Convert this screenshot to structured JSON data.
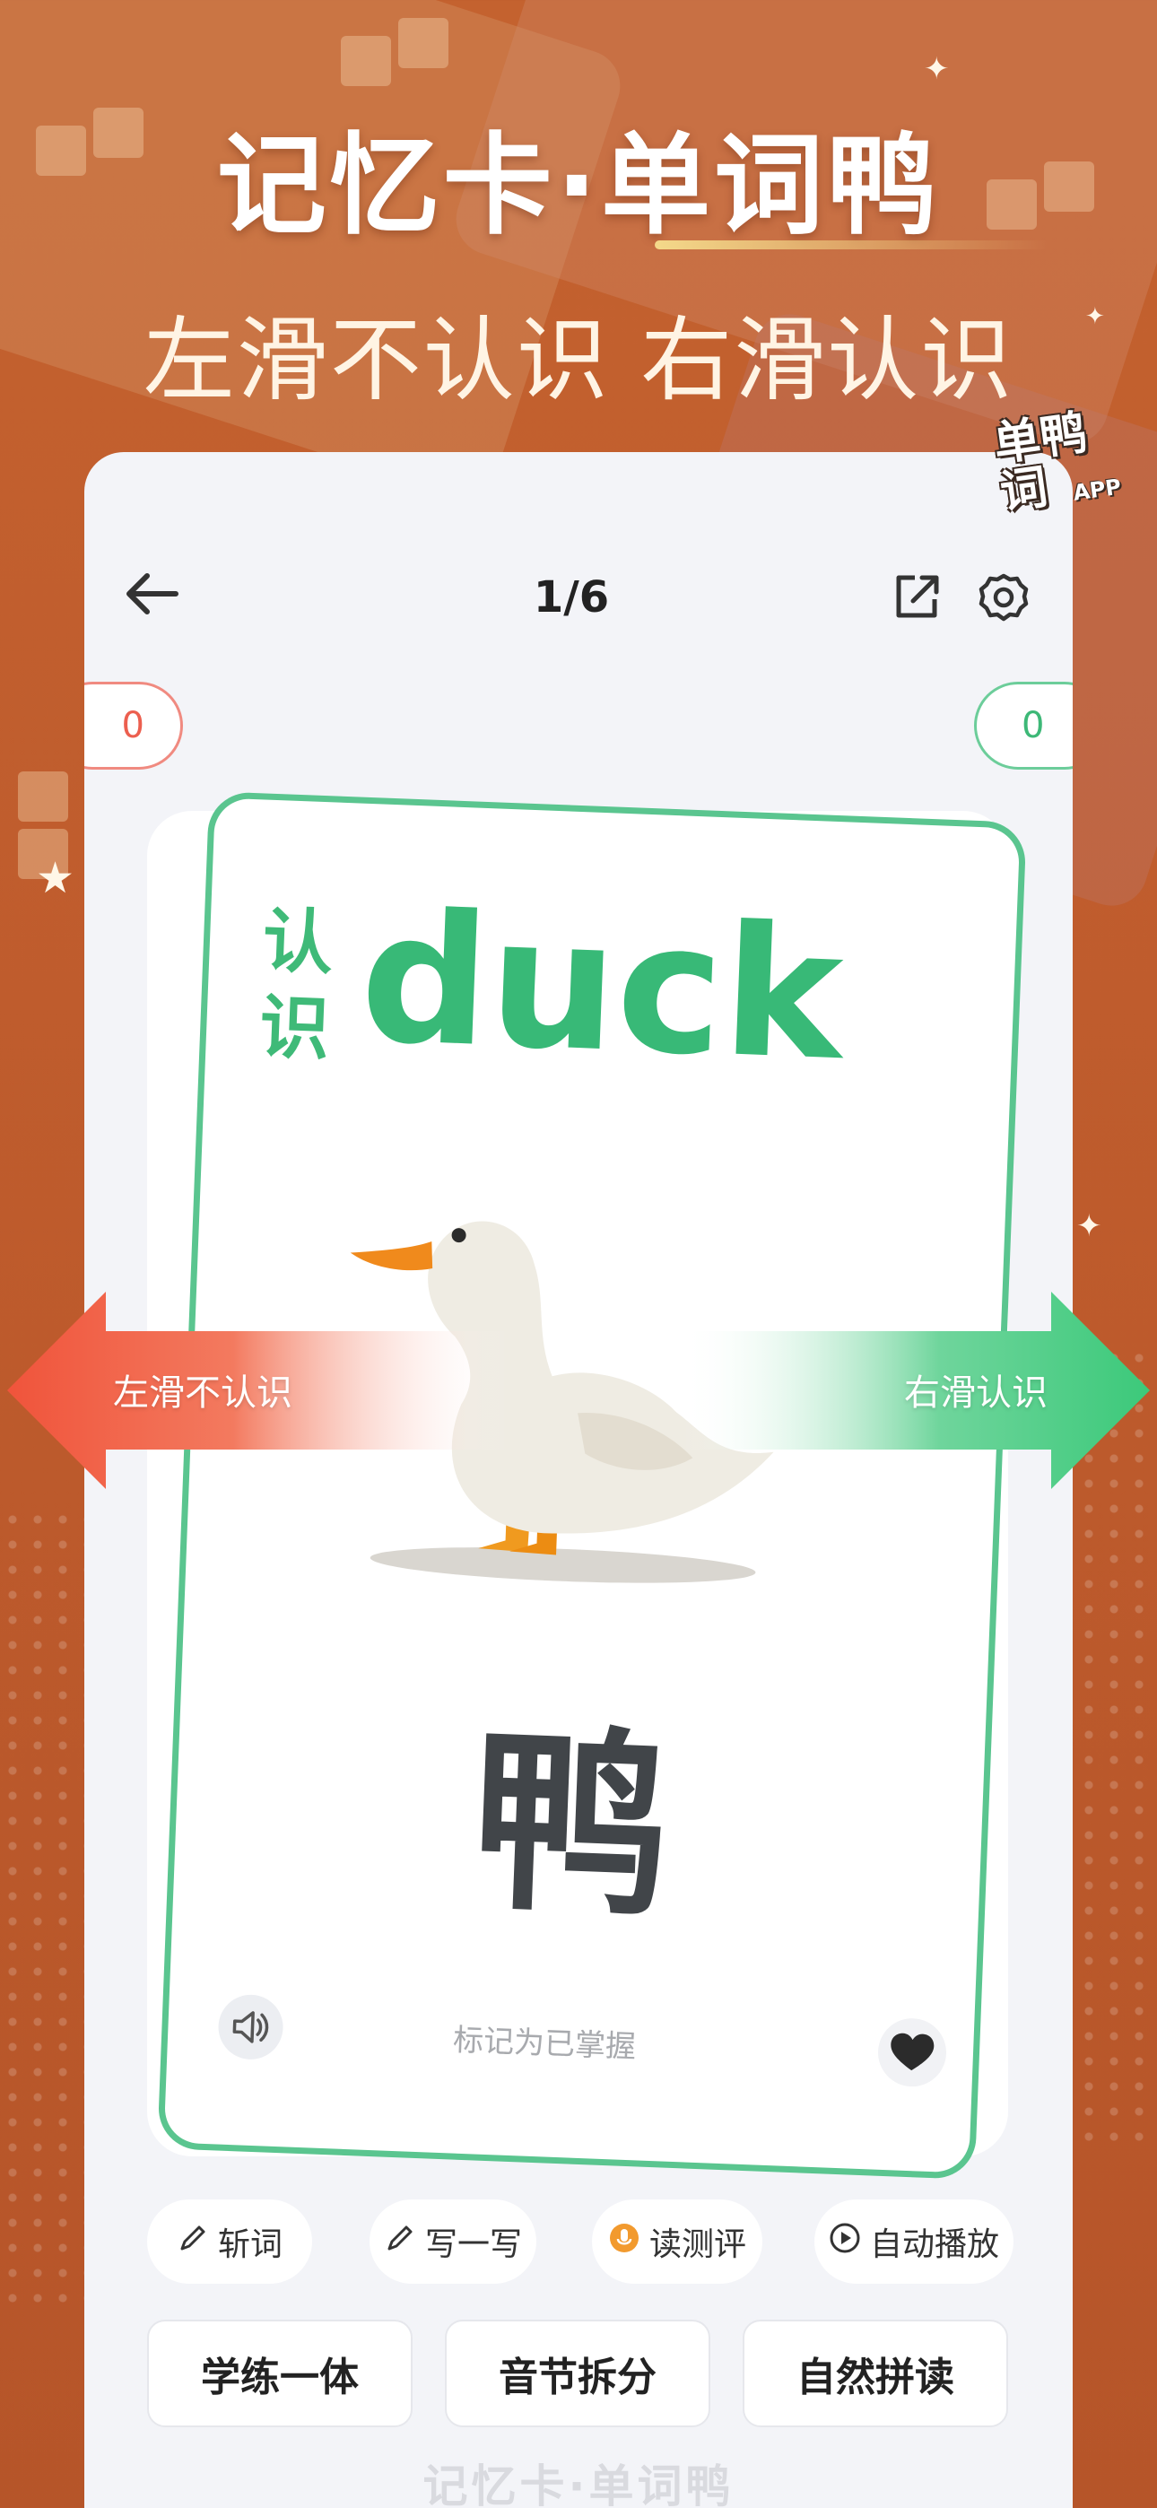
{
  "promo": {
    "headline": "记忆卡·单词鸭",
    "subline": "左滑不认识 右滑认识",
    "badge_word": "单鸭\n词",
    "badge_app": "APP"
  },
  "nav": {
    "progress": "1/6",
    "back_icon": "back-arrow-icon",
    "share_icon": "share-icon",
    "settings_icon": "gear-icon"
  },
  "counters": {
    "unknown": "0",
    "known": "0"
  },
  "card": {
    "tag": "认识",
    "word": "duck",
    "chinese": "鸭",
    "mark_label": "标记为已掌握",
    "image": "duck-illustration"
  },
  "swipe": {
    "left_label": "左滑不认识",
    "right_label": "右滑认识"
  },
  "tools": [
    {
      "label": "斩词",
      "icon": "pencil-icon"
    },
    {
      "label": "写一写",
      "icon": "pencil-icon"
    },
    {
      "label": "读测评",
      "icon": "mic-icon"
    },
    {
      "label": "自动播放",
      "icon": "play-icon"
    }
  ],
  "buttons": [
    {
      "label": "学练一体"
    },
    {
      "label": "音节拆分"
    },
    {
      "label": "自然拼读"
    }
  ],
  "footer": "记忆卡·单词鸭",
  "colors": {
    "background": "#c4622f",
    "green_accent": "#38b977",
    "red_accent": "#ec5f4f"
  }
}
